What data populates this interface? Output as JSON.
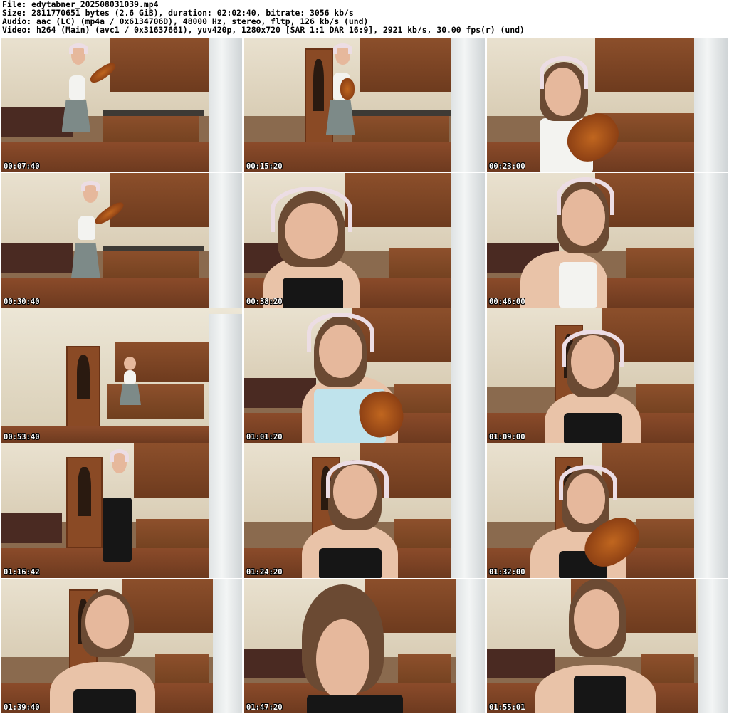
{
  "header": {
    "line_file": "File: edytabner_202508031039.mp4",
    "line_size": "Size: 2811770651 bytes (2.6 GiB), duration: 02:02:40, bitrate: 3056 kb/s",
    "line_audio": "Audio: aac (LC) (mp4a / 0x6134706D), 48000 Hz, stereo, fltp, 126 kb/s (und)",
    "line_video": "Video: h264 (Main) (avc1 / 0x31637661), yuv420p, 1280x720 [SAR 1:1 DAR 16:9], 2921 kb/s, 30.00 fps(r) (und)"
  },
  "thumbnails": [
    {
      "time": "00:07:40"
    },
    {
      "time": "00:15:20"
    },
    {
      "time": "00:23:00"
    },
    {
      "time": "00:30:40"
    },
    {
      "time": "00:38:20"
    },
    {
      "time": "00:46:00"
    },
    {
      "time": "00:53:40"
    },
    {
      "time": "01:01:20"
    },
    {
      "time": "01:09:00"
    },
    {
      "time": "01:16:42"
    },
    {
      "time": "01:24:20"
    },
    {
      "time": "01:32:00"
    },
    {
      "time": "01:39:40"
    },
    {
      "time": "01:47:20"
    },
    {
      "time": "01:55:01"
    }
  ]
}
